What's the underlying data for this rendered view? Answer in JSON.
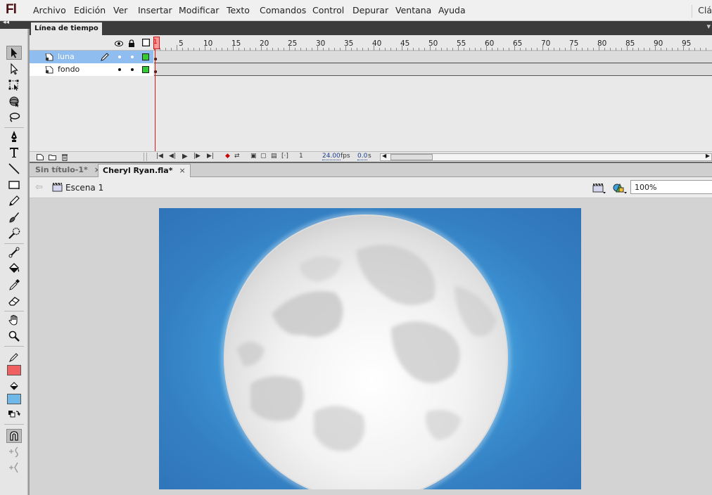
{
  "app": {
    "logo": "Fl",
    "menu": [
      "Archivo",
      "Edición",
      "Ver",
      "Insertar",
      "Modificar",
      "Texto",
      "Comandos",
      "Control",
      "Depurar",
      "Ventana",
      "Ayuda"
    ],
    "workspace_label": "Clá"
  },
  "tools_panel": {
    "collapse_label": "◂◂",
    "tools": [
      "selection-tool",
      "subselection-tool",
      "free-transform-tool",
      "3d-rotation-tool",
      "lasso-tool",
      "pen-tool",
      "text-tool",
      "line-tool",
      "rectangle-tool",
      "pencil-tool",
      "brush-tool",
      "deco-tool",
      "bone-tool",
      "paint-bucket-tool",
      "eyedropper-tool",
      "eraser-tool",
      "hand-tool",
      "zoom-tool"
    ],
    "stroke_color": "#f06060",
    "fill_color": "#6fb8e8"
  },
  "timeline": {
    "tab_label": "Línea de tiempo",
    "frame_numbers": [
      "5",
      "10",
      "15",
      "20",
      "25",
      "30",
      "35",
      "40",
      "45",
      "50",
      "55",
      "60",
      "65",
      "70",
      "75",
      "80",
      "85",
      "90",
      "95"
    ],
    "current_frame_label": "1",
    "layers": [
      {
        "name": "luna",
        "selected": true,
        "color": "#33cc33"
      },
      {
        "name": "fondo",
        "selected": false,
        "color": "#33cc33"
      }
    ],
    "footer": {
      "current_frame": "1",
      "fps_value": "24.00",
      "fps_unit": "fps",
      "time_value": "0.0",
      "time_unit": "s"
    }
  },
  "documents": {
    "tabs": [
      {
        "label": "Sin título-1*",
        "close": "×",
        "active": false
      },
      {
        "label": "Cheryl Ryan.fla*",
        "close": "×",
        "active": true
      }
    ]
  },
  "edit_bar": {
    "scene_label": "Escena 1",
    "zoom": "100%"
  },
  "colors": {
    "selected_layer": "#8fbdf0",
    "playhead": "#e21818",
    "stage_blue": "#2f74b8"
  }
}
